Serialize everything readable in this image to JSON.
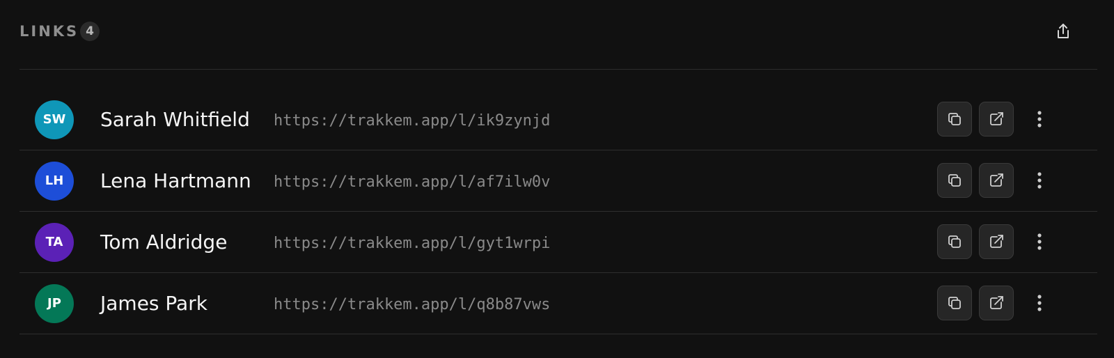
{
  "header": {
    "title": "LINKS",
    "count": "4",
    "share_icon": "share-upload-icon"
  },
  "links": [
    {
      "initials": "SW",
      "name": "Sarah Whitfield",
      "url": "https://trakkem.app/l/ik9zynjd",
      "avatar_color": "#0f97b8"
    },
    {
      "initials": "LH",
      "name": "Lena Hartmann",
      "url": "https://trakkem.app/l/af7ilw0v",
      "avatar_color": "#1d4ed8"
    },
    {
      "initials": "TA",
      "name": "Tom Aldridge",
      "url": "https://trakkem.app/l/gyt1wrpi",
      "avatar_color": "#5b21b6"
    },
    {
      "initials": "JP",
      "name": "James Park",
      "url": "https://trakkem.app/l/q8b87vws",
      "avatar_color": "#047857"
    }
  ],
  "row_actions": {
    "copy_icon": "copy-icon",
    "open_icon": "external-link-icon",
    "more_icon": "more-vertical-icon"
  },
  "colors": {
    "background": "#111111",
    "divider": "#2e2e2e",
    "button_bg": "#262626"
  }
}
